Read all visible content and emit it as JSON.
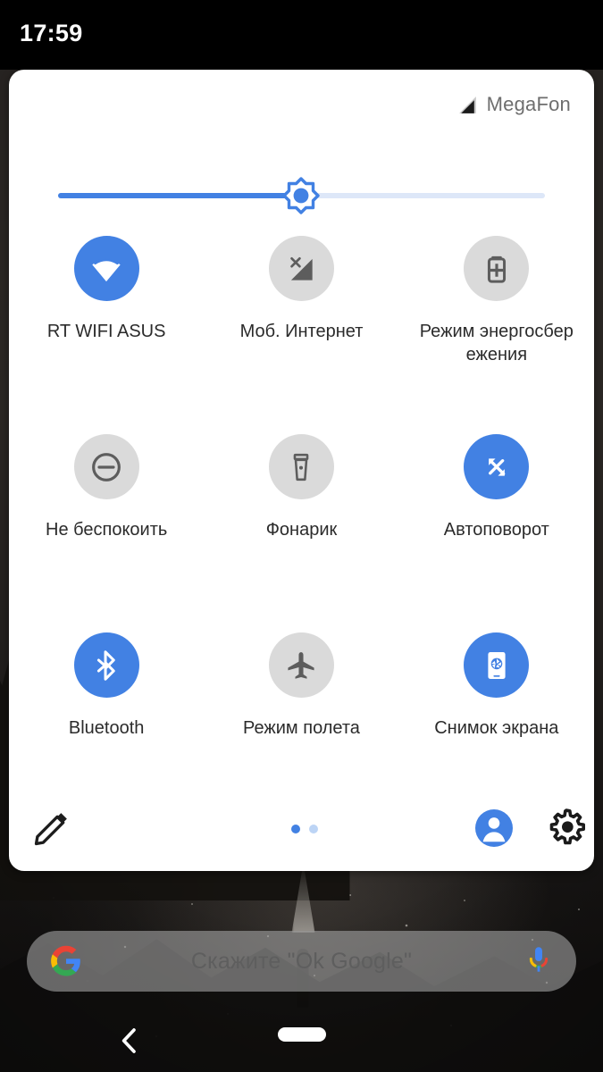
{
  "status_bar": {
    "clock": "17:59"
  },
  "quick_settings": {
    "carrier": {
      "name": "MegaFon",
      "signal_icon": "signal-triangle-icon"
    },
    "brightness": {
      "icon": "brightness-sun-icon",
      "value_percent": 50
    },
    "tiles": [
      [
        {
          "label": "RT WIFI ASUS",
          "icon": "wifi-icon",
          "state": "on",
          "name": "tile-wifi"
        },
        {
          "label": "Моб. Интернет",
          "icon": "mobile-data-off-icon",
          "state": "off",
          "name": "tile-mobile-data"
        },
        {
          "label": "Режим энергосбережения",
          "icon": "battery-saver-icon",
          "state": "off",
          "name": "tile-battery-saver"
        }
      ],
      [
        {
          "label": "Не беспокоить",
          "icon": "do-not-disturb-icon",
          "state": "off",
          "name": "tile-do-not-disturb"
        },
        {
          "label": "Фонарик",
          "icon": "flashlight-icon",
          "state": "off",
          "name": "tile-flashlight"
        },
        {
          "label": "Автоповорот",
          "icon": "auto-rotate-icon",
          "state": "on",
          "name": "tile-auto-rotate"
        }
      ],
      [
        {
          "label": "Bluetooth",
          "icon": "bluetooth-icon",
          "state": "on",
          "name": "tile-bluetooth"
        },
        {
          "label": "Режим полета",
          "icon": "airplane-icon",
          "state": "off",
          "name": "tile-airplane-mode"
        },
        {
          "label": "Снимок экрана",
          "icon": "screenshot-icon",
          "state": "on",
          "name": "tile-screenshot"
        }
      ]
    ],
    "footer": {
      "edit_icon": "pencil-icon",
      "user_icon": "user-avatar-icon",
      "settings_icon": "gear-icon",
      "pages": {
        "count": 2,
        "active_index": 0
      }
    }
  },
  "search": {
    "placeholder": "Скажите \"Ok Google\"",
    "logo_icon": "google-g-icon",
    "mic_icon": "microphone-icon"
  },
  "nav_bar": {
    "back_icon": "back-chevron-icon",
    "home_icon": "home-pill-icon"
  },
  "colors": {
    "accent_blue": "#4281e3",
    "tile_off_gray": "#dadada",
    "tile_icon_gray": "#6b6b6b",
    "panel_bg": "#ffffff",
    "status_bar_bg": "#000000",
    "label_text": "#2b2b2b",
    "carrier_text": "#6e6e6e"
  }
}
